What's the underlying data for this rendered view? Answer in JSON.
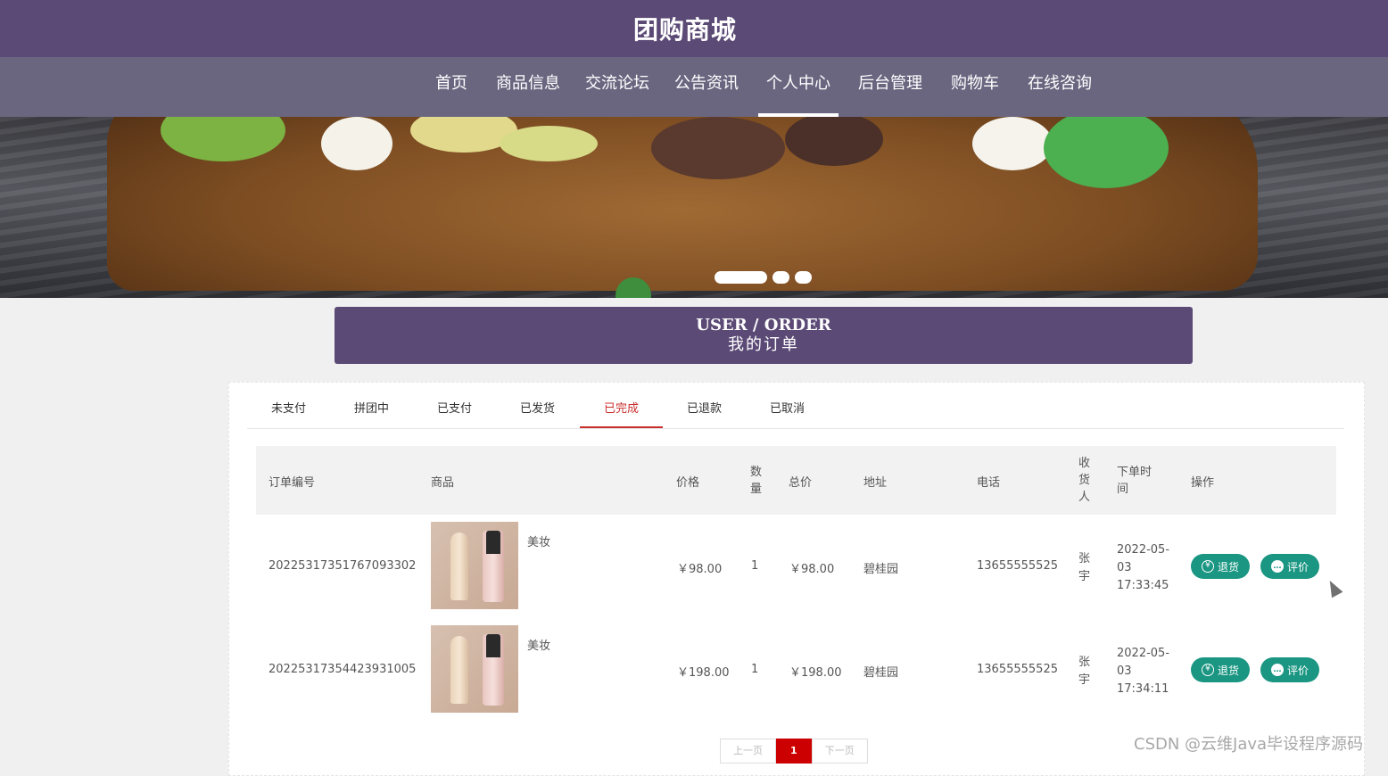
{
  "site": {
    "title": "团购商城"
  },
  "nav": {
    "items": [
      {
        "label": "首页"
      },
      {
        "label": "商品信息"
      },
      {
        "label": "交流论坛"
      },
      {
        "label": "公告资讯"
      },
      {
        "label": "个人中心",
        "active": true
      },
      {
        "label": "后台管理"
      },
      {
        "label": "购物车"
      },
      {
        "label": "在线咨询"
      }
    ]
  },
  "banner": {
    "slides": 3,
    "active_slide": 1
  },
  "page_header": {
    "en": "USER / ORDER",
    "cn": "我的订单"
  },
  "tabs": [
    {
      "label": "未支付"
    },
    {
      "label": "拼团中"
    },
    {
      "label": "已支付"
    },
    {
      "label": "已发货"
    },
    {
      "label": "已完成",
      "active": true
    },
    {
      "label": "已退款"
    },
    {
      "label": "已取消"
    }
  ],
  "table": {
    "headers": {
      "order_no": "订单编号",
      "product": "商品",
      "price": "价格",
      "qty": "数量",
      "total": "总价",
      "address": "地址",
      "phone": "电话",
      "receiver": "收货人",
      "time": "下单时间",
      "action": "操作"
    },
    "rows": [
      {
        "order_no": "20225317351767093302",
        "product": "美妆",
        "price": "￥98.00",
        "qty": "1",
        "total": "￥98.00",
        "address": "碧桂园",
        "phone": "13655555525",
        "receiver": "张宇",
        "time": "2022-05-03 17:33:45"
      },
      {
        "order_no": "20225317354423931005",
        "product": "美妆",
        "price": "￥198.00",
        "qty": "1",
        "total": "￥198.00",
        "address": "碧桂园",
        "phone": "13655555525",
        "receiver": "张宇",
        "time": "2022-05-03 17:34:11"
      }
    ],
    "buttons": {
      "refund": "退货",
      "review": "评价"
    }
  },
  "pagination": {
    "prev": "上一页",
    "current": "1",
    "next": "下一页"
  },
  "watermark": "CSDN @云维Java毕设程序源码",
  "colors": {
    "header_bg": "#5b4a75",
    "nav_bg": "#6b6680",
    "action_btn": "#1a9682",
    "active_tab": "#c9302c",
    "page_current": "#cc0000"
  }
}
